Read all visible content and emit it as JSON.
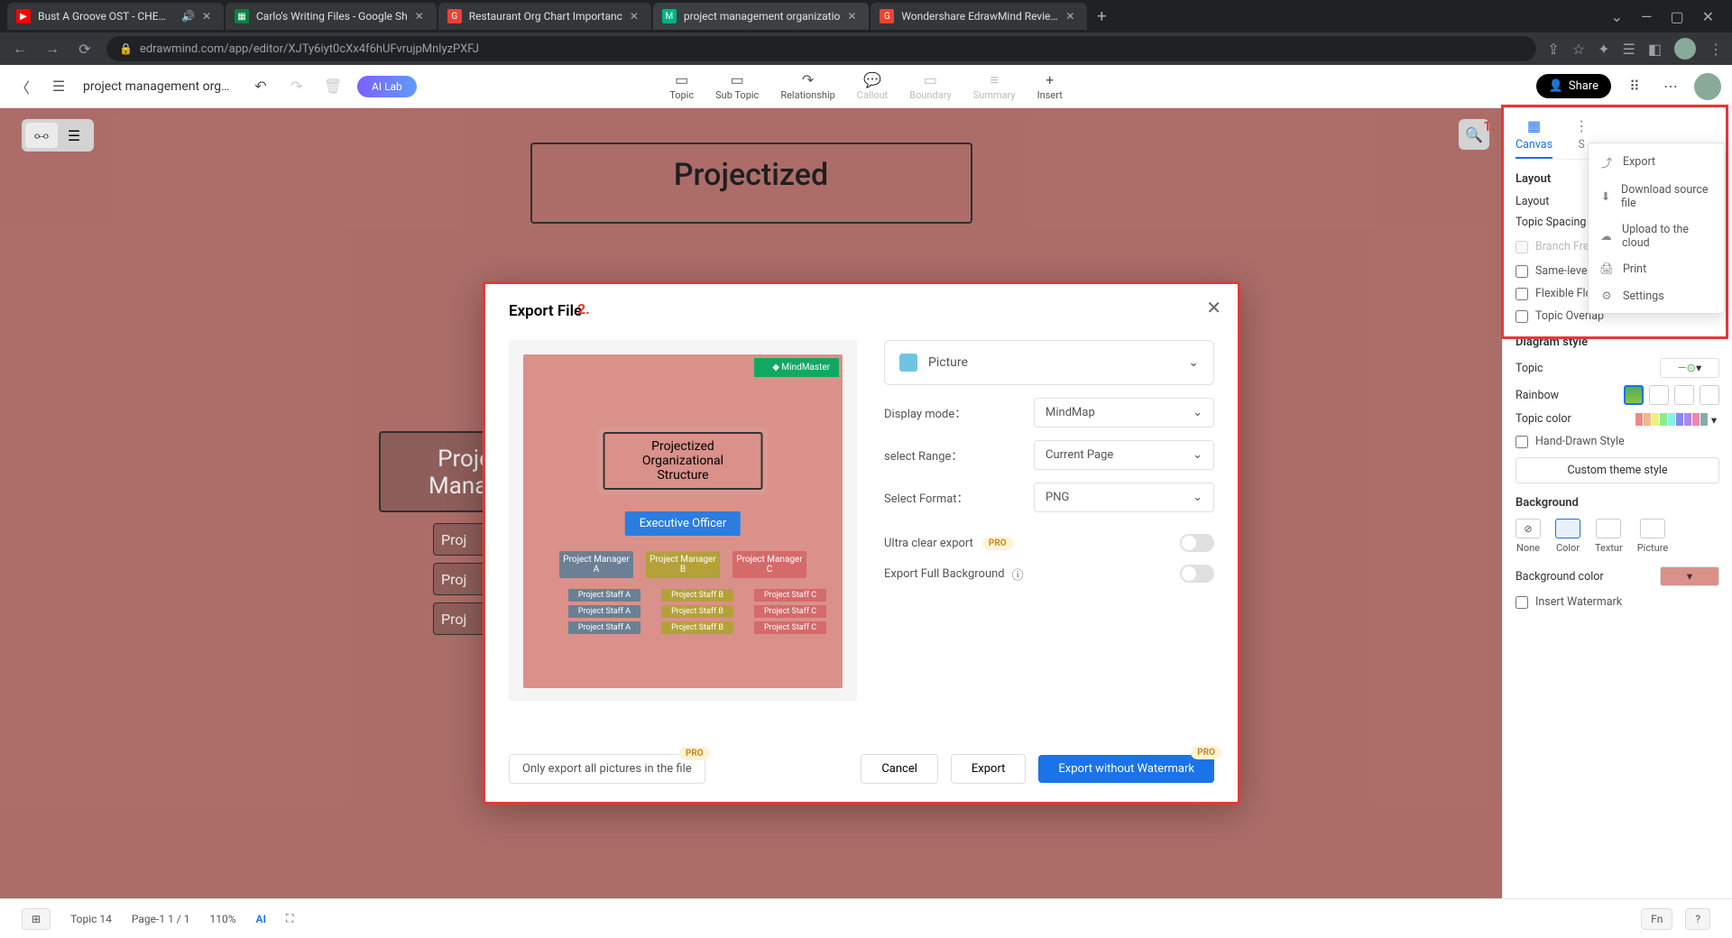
{
  "browser": {
    "tabs": [
      {
        "title": "Bust A Groove OST - CHEMIC",
        "favicon": "▶"
      },
      {
        "title": "Carlo's Writing Files - Google Sh",
        "favicon": "▦"
      },
      {
        "title": "Restaurant Org Chart Importanc",
        "favicon": "G"
      },
      {
        "title": "project management organizatio",
        "favicon": "M"
      },
      {
        "title": "Wondershare EdrawMind Review",
        "favicon": "G"
      }
    ],
    "url": "edrawmind.com/app/editor/XJTy6iyt0cXx4f6hUFvrujpMnlyzPXFJ"
  },
  "topbar": {
    "title": "project management orga...",
    "ailab": "AI Lab",
    "tools": [
      {
        "label": "Topic",
        "disabled": false
      },
      {
        "label": "Sub Topic",
        "disabled": false
      },
      {
        "label": "Relationship",
        "disabled": false
      },
      {
        "label": "Callout",
        "disabled": true
      },
      {
        "label": "Boundary",
        "disabled": true
      },
      {
        "label": "Summary",
        "disabled": true
      },
      {
        "label": "Insert",
        "disabled": false
      }
    ],
    "share": "Share"
  },
  "moremenu": {
    "items": [
      "Export",
      "Download source file",
      "Upload to the cloud",
      "Print",
      "Settings"
    ]
  },
  "canvas": {
    "title": "Projectized",
    "mgr": "Proje\nManag",
    "staff": [
      "Proj",
      "Proj",
      "Proj"
    ]
  },
  "statusbar": {
    "topic": "Topic 14",
    "page": "Page-1  1 / 1",
    "zoom": "110%",
    "ai": "AI"
  },
  "sidepanel": {
    "tabs": [
      "Canvas",
      "S"
    ],
    "layoutHeading": "Layout",
    "layoutLabel": "Layout",
    "topicSpacing": "Topic Spacing",
    "branchFree": "Branch Free Positioning",
    "sameLevel": "Same-level Topics Alignment",
    "flexFloat": "Flexible Floating topoc",
    "topicOverlap": "Topic Overlap",
    "diagramStyle": "Diagram style",
    "topic": "Topic",
    "rainbow": "Rainbow",
    "topicColor": "Topic color",
    "handDrawn": "Hand-Drawn Style",
    "customTheme": "Custom theme style",
    "backgroundHeading": "Background",
    "bgOpts": [
      "None",
      "Color",
      "Textur",
      "Picture"
    ],
    "bgColorLabel": "Background color",
    "bgColor": "#d9918a",
    "insertWatermark": "Insert Watermark"
  },
  "annotations": {
    "num1": "1.",
    "num2": "2."
  },
  "modal": {
    "title": "Export File",
    "typeLabel": "Picture",
    "rows": {
      "displayMode": {
        "label": "Display mode：",
        "value": "MindMap"
      },
      "selectRange": {
        "label": "select Range：",
        "value": "Current Page"
      },
      "selectFormat": {
        "label": "Select Format：",
        "value": "PNG"
      }
    },
    "ultraClear": "Ultra clear export",
    "exportFullBg": "Export Full Background",
    "pro": "PRO",
    "onlyExport": "Only export all pictures in the file",
    "cancel": "Cancel",
    "export": "Export",
    "exportNoWm": "Export without Watermark",
    "preview": {
      "titleLine1": "Projectized",
      "titleLine2": "Organizational Structure",
      "exec": "Executive Officer",
      "mgrs": [
        "Project Manager A",
        "Project Manager B",
        "Project Manager C"
      ],
      "staffA": [
        "Project Staff A",
        "Project Staff A",
        "Project Staff A"
      ],
      "staffB": [
        "Project Staff B",
        "Project Staff B",
        "Project Staff B"
      ],
      "staffC": [
        "Project Staff C",
        "Project Staff C",
        "Project Staff C"
      ]
    }
  }
}
